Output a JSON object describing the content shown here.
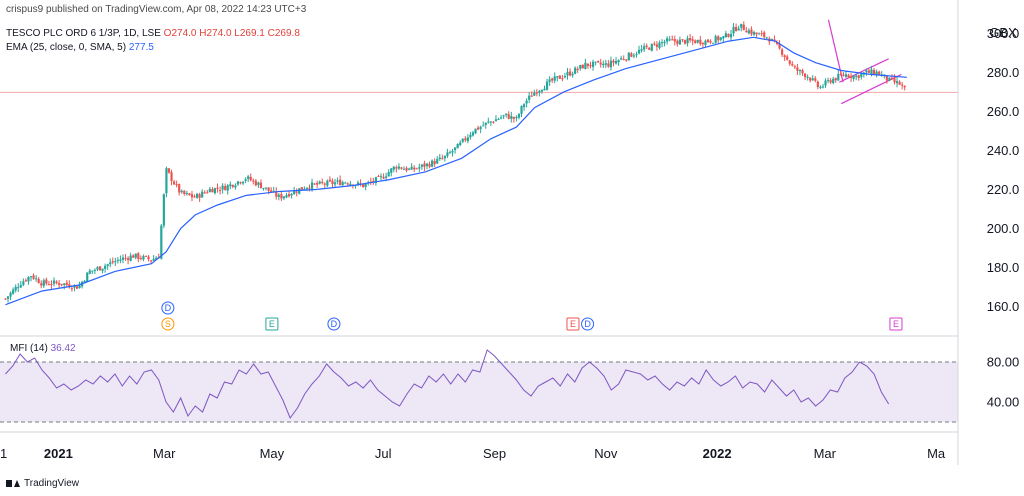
{
  "header": {
    "published": "crispus9 published on TradingView.com, Apr 08, 2022 14:23 UTC+3",
    "symbol_line": "TESCO PLC ORD 6 1/3P, 1D, LSE",
    "ohlc": "O274.0  H274.0  L269.1  C269.8",
    "ema_label": "EMA (25, close, 0, SMA, 5)",
    "ema_value": "277.5",
    "mfi_label": "MFI (14)",
    "mfi_value": "36.42",
    "brand": "TradingView"
  },
  "colors": {
    "up": "#26a69a",
    "down": "#ef5350",
    "ema": "#2962ff",
    "mfi": "#7e57c2",
    "mfi_band": "#ede7f6",
    "trendline": "#d63ccf",
    "last_price_line": "#f2a7a7"
  },
  "chart_data": [
    {
      "type": "candlestick",
      "title": "TESCO PLC ORD 6 1/3P, 1D, LSE",
      "currency": "GBX",
      "ylim": [
        148,
        312
      ],
      "yticks": [
        "160.0",
        "180.0",
        "200.0",
        "220.0",
        "240.0",
        "260.0",
        "280.0",
        "300.0"
      ],
      "ytick_values": [
        160,
        180,
        200,
        220,
        240,
        260,
        280,
        300
      ],
      "xticks": [
        {
          "label": "1",
          "bold": false
        },
        {
          "label": "2021",
          "bold": true
        },
        {
          "label": "Mar",
          "bold": false
        },
        {
          "label": "May",
          "bold": false
        },
        {
          "label": "Jul",
          "bold": false
        },
        {
          "label": "Sep",
          "bold": false
        },
        {
          "label": "Nov",
          "bold": false
        },
        {
          "label": "2022",
          "bold": true
        },
        {
          "label": "Mar",
          "bold": false
        },
        {
          "label": "Ma",
          "bold": false
        }
      ],
      "xtick_days": [
        -3,
        29,
        87,
        146,
        207,
        268,
        329,
        390,
        449,
        510
      ],
      "xrange_days": [
        -3,
        522
      ],
      "close_path": [
        [
          0,
          164
        ],
        [
          8,
          172
        ],
        [
          14,
          176
        ],
        [
          20,
          172
        ],
        [
          30,
          172
        ],
        [
          40,
          170
        ],
        [
          46,
          178
        ],
        [
          52,
          180
        ],
        [
          62,
          184
        ],
        [
          70,
          186
        ],
        [
          80,
          184
        ],
        [
          84,
          186
        ],
        [
          88,
          230
        ],
        [
          92,
          224
        ],
        [
          96,
          218
        ],
        [
          104,
          216
        ],
        [
          112,
          220
        ],
        [
          120,
          221
        ],
        [
          132,
          226
        ],
        [
          140,
          222
        ],
        [
          150,
          216
        ],
        [
          158,
          219
        ],
        [
          166,
          222
        ],
        [
          176,
          223
        ],
        [
          186,
          224
        ],
        [
          196,
          222
        ],
        [
          206,
          226
        ],
        [
          214,
          232
        ],
        [
          222,
          230
        ],
        [
          232,
          233
        ],
        [
          240,
          236
        ],
        [
          248,
          242
        ],
        [
          256,
          250
        ],
        [
          264,
          254
        ],
        [
          274,
          258
        ],
        [
          280,
          256
        ],
        [
          284,
          264
        ],
        [
          290,
          270
        ],
        [
          300,
          276
        ],
        [
          310,
          280
        ],
        [
          318,
          284
        ],
        [
          330,
          284
        ],
        [
          340,
          288
        ],
        [
          350,
          292
        ],
        [
          362,
          296
        ],
        [
          374,
          296
        ],
        [
          384,
          296
        ],
        [
          394,
          298
        ],
        [
          402,
          304
        ],
        [
          410,
          300
        ],
        [
          418,
          298
        ],
        [
          426,
          290
        ],
        [
          432,
          282
        ],
        [
          440,
          278
        ],
        [
          446,
          272
        ],
        [
          452,
          276
        ],
        [
          460,
          279
        ],
        [
          466,
          278
        ],
        [
          472,
          280
        ],
        [
          478,
          280
        ],
        [
          484,
          276
        ],
        [
          490,
          274
        ],
        [
          494,
          270
        ]
      ],
      "ema_path": [
        [
          0,
          161
        ],
        [
          20,
          168
        ],
        [
          40,
          171
        ],
        [
          60,
          178
        ],
        [
          80,
          182
        ],
        [
          88,
          188
        ],
        [
          96,
          200
        ],
        [
          104,
          207
        ],
        [
          116,
          212
        ],
        [
          132,
          217
        ],
        [
          150,
          219
        ],
        [
          170,
          220
        ],
        [
          190,
          222
        ],
        [
          210,
          225
        ],
        [
          230,
          229
        ],
        [
          250,
          236
        ],
        [
          266,
          246
        ],
        [
          280,
          252
        ],
        [
          290,
          262
        ],
        [
          306,
          270
        ],
        [
          322,
          276
        ],
        [
          340,
          282
        ],
        [
          360,
          287
        ],
        [
          380,
          292
        ],
        [
          396,
          296
        ],
        [
          410,
          298
        ],
        [
          422,
          296
        ],
        [
          432,
          290
        ],
        [
          444,
          285
        ],
        [
          458,
          281
        ],
        [
          474,
          279
        ],
        [
          494,
          277.5
        ]
      ],
      "last_close": 269.8,
      "trendlines": [
        {
          "from": [
            451,
            307
          ],
          "to": [
            459,
            275
          ]
        },
        {
          "from": [
            458,
            264
          ],
          "to": [
            491,
            279
          ]
        },
        {
          "from": [
            457,
            275
          ],
          "to": [
            484,
            287
          ]
        }
      ],
      "events": [
        {
          "letter": "D",
          "day": 89,
          "row": 0,
          "color": "#2962ff"
        },
        {
          "letter": "S",
          "day": 89,
          "row": 1,
          "color": "#ff9800"
        },
        {
          "letter": "E",
          "day": 146,
          "row": 1,
          "color": "#26a69a"
        },
        {
          "letter": "D",
          "day": 180,
          "row": 1,
          "color": "#2962ff"
        },
        {
          "letter": "E",
          "day": 311,
          "row": 1,
          "color": "#ef5350"
        },
        {
          "letter": "D",
          "day": 319,
          "row": 1,
          "color": "#2962ff"
        },
        {
          "letter": "E",
          "day": 488,
          "row": 1,
          "color": "#d63ccf"
        }
      ]
    },
    {
      "type": "line",
      "title": "MFI (14)",
      "ylim": [
        16,
        100
      ],
      "yticks": [
        "40.00",
        "80.00"
      ],
      "ytick_values": [
        40,
        80
      ],
      "band": [
        20,
        80
      ],
      "last_value": 36.42,
      "path": [
        [
          0,
          68
        ],
        [
          4,
          76
        ],
        [
          8,
          88
        ],
        [
          12,
          80
        ],
        [
          16,
          84
        ],
        [
          20,
          72
        ],
        [
          24,
          64
        ],
        [
          28,
          54
        ],
        [
          32,
          58
        ],
        [
          36,
          52
        ],
        [
          40,
          56
        ],
        [
          44,
          62
        ],
        [
          48,
          58
        ],
        [
          52,
          66
        ],
        [
          56,
          60
        ],
        [
          60,
          68
        ],
        [
          64,
          56
        ],
        [
          68,
          66
        ],
        [
          72,
          58
        ],
        [
          76,
          70
        ],
        [
          80,
          72
        ],
        [
          84,
          62
        ],
        [
          88,
          40
        ],
        [
          92,
          30
        ],
        [
          96,
          44
        ],
        [
          100,
          26
        ],
        [
          104,
          36
        ],
        [
          108,
          30
        ],
        [
          112,
          48
        ],
        [
          116,
          44
        ],
        [
          120,
          60
        ],
        [
          124,
          58
        ],
        [
          128,
          72
        ],
        [
          132,
          68
        ],
        [
          136,
          78
        ],
        [
          140,
          68
        ],
        [
          144,
          70
        ],
        [
          148,
          56
        ],
        [
          152,
          42
        ],
        [
          156,
          24
        ],
        [
          160,
          34
        ],
        [
          164,
          48
        ],
        [
          168,
          58
        ],
        [
          172,
          66
        ],
        [
          176,
          78
        ],
        [
          180,
          70
        ],
        [
          184,
          64
        ],
        [
          188,
          56
        ],
        [
          192,
          60
        ],
        [
          196,
          54
        ],
        [
          200,
          62
        ],
        [
          204,
          52
        ],
        [
          208,
          46
        ],
        [
          212,
          40
        ],
        [
          216,
          36
        ],
        [
          220,
          48
        ],
        [
          224,
          58
        ],
        [
          228,
          54
        ],
        [
          232,
          66
        ],
        [
          236,
          60
        ],
        [
          240,
          68
        ],
        [
          244,
          58
        ],
        [
          248,
          68
        ],
        [
          252,
          60
        ],
        [
          256,
          72
        ],
        [
          260,
          70
        ],
        [
          264,
          92
        ],
        [
          268,
          86
        ],
        [
          272,
          78
        ],
        [
          276,
          70
        ],
        [
          280,
          62
        ],
        [
          284,
          52
        ],
        [
          288,
          46
        ],
        [
          292,
          56
        ],
        [
          296,
          60
        ],
        [
          300,
          64
        ],
        [
          304,
          56
        ],
        [
          308,
          68
        ],
        [
          312,
          60
        ],
        [
          316,
          74
        ],
        [
          320,
          80
        ],
        [
          324,
          74
        ],
        [
          328,
          66
        ],
        [
          332,
          52
        ],
        [
          336,
          58
        ],
        [
          340,
          72
        ],
        [
          344,
          70
        ],
        [
          348,
          68
        ],
        [
          352,
          62
        ],
        [
          356,
          66
        ],
        [
          360,
          58
        ],
        [
          364,
          52
        ],
        [
          368,
          60
        ],
        [
          372,
          56
        ],
        [
          376,
          64
        ],
        [
          380,
          58
        ],
        [
          384,
          72
        ],
        [
          388,
          62
        ],
        [
          392,
          56
        ],
        [
          396,
          60
        ],
        [
          400,
          66
        ],
        [
          404,
          54
        ],
        [
          408,
          60
        ],
        [
          412,
          58
        ],
        [
          416,
          50
        ],
        [
          420,
          62
        ],
        [
          424,
          54
        ],
        [
          428,
          46
        ],
        [
          432,
          52
        ],
        [
          436,
          40
        ],
        [
          440,
          44
        ],
        [
          444,
          36
        ],
        [
          448,
          42
        ],
        [
          452,
          52
        ],
        [
          456,
          50
        ],
        [
          460,
          64
        ],
        [
          464,
          70
        ],
        [
          468,
          80
        ],
        [
          472,
          76
        ],
        [
          476,
          68
        ],
        [
          480,
          50
        ],
        [
          484,
          38
        ]
      ]
    }
  ]
}
